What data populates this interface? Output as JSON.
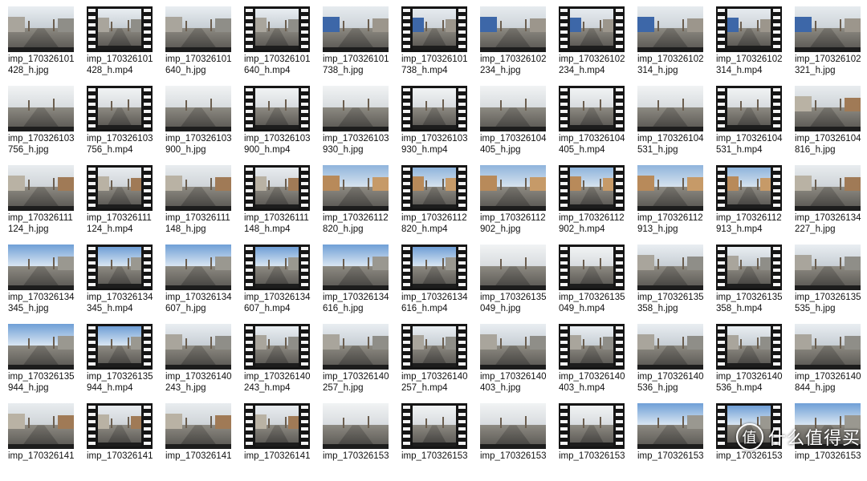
{
  "files": [
    {
      "line1": "imp_170326101",
      "line2": "428_h.jpg",
      "type": "jpg",
      "scene": "city"
    },
    {
      "line1": "imp_170326101",
      "line2": "428_h.mp4",
      "type": "mp4",
      "scene": "city"
    },
    {
      "line1": "imp_170326101",
      "line2": "640_h.jpg",
      "type": "jpg",
      "scene": "city"
    },
    {
      "line1": "imp_170326101",
      "line2": "640_h.mp4",
      "type": "mp4",
      "scene": "city"
    },
    {
      "line1": "imp_170326101",
      "line2": "738_h.jpg",
      "type": "jpg",
      "scene": "bluewall"
    },
    {
      "line1": "imp_170326101",
      "line2": "738_h.mp4",
      "type": "mp4",
      "scene": "bluewall"
    },
    {
      "line1": "imp_170326102",
      "line2": "234_h.jpg",
      "type": "jpg",
      "scene": "bluewall"
    },
    {
      "line1": "imp_170326102",
      "line2": "234_h.mp4",
      "type": "mp4",
      "scene": "bluewall"
    },
    {
      "line1": "imp_170326102",
      "line2": "314_h.jpg",
      "type": "jpg",
      "scene": "bluewall"
    },
    {
      "line1": "imp_170326102",
      "line2": "314_h.mp4",
      "type": "mp4",
      "scene": "bluewall"
    },
    {
      "line1": "imp_170326102",
      "line2": "321_h.jpg",
      "type": "jpg",
      "scene": "bluewall"
    },
    {
      "line1": "imp_170326103",
      "line2": "756_h.jpg",
      "type": "jpg",
      "scene": "open"
    },
    {
      "line1": "imp_170326103",
      "line2": "756_h.mp4",
      "type": "mp4",
      "scene": "open"
    },
    {
      "line1": "imp_170326103",
      "line2": "900_h.jpg",
      "type": "jpg",
      "scene": "open"
    },
    {
      "line1": "imp_170326103",
      "line2": "900_h.mp4",
      "type": "mp4",
      "scene": "open"
    },
    {
      "line1": "imp_170326103",
      "line2": "930_h.jpg",
      "type": "jpg",
      "scene": "open"
    },
    {
      "line1": "imp_170326103",
      "line2": "930_h.mp4",
      "type": "mp4",
      "scene": "open"
    },
    {
      "line1": "imp_170326104",
      "line2": "405_h.jpg",
      "type": "jpg",
      "scene": "open"
    },
    {
      "line1": "imp_170326104",
      "line2": "405_h.mp4",
      "type": "mp4",
      "scene": "open"
    },
    {
      "line1": "imp_170326104",
      "line2": "531_h.jpg",
      "type": "jpg",
      "scene": "open"
    },
    {
      "line1": "imp_170326104",
      "line2": "531_h.mp4",
      "type": "mp4",
      "scene": "open"
    },
    {
      "line1": "imp_170326104",
      "line2": "816_h.jpg",
      "type": "jpg",
      "scene": "village"
    },
    {
      "line1": "imp_170326111",
      "line2": "124_h.jpg",
      "type": "jpg",
      "scene": "village"
    },
    {
      "line1": "imp_170326111",
      "line2": "124_h.mp4",
      "type": "mp4",
      "scene": "village"
    },
    {
      "line1": "imp_170326111",
      "line2": "148_h.jpg",
      "type": "jpg",
      "scene": "village"
    },
    {
      "line1": "imp_170326111",
      "line2": "148_h.mp4",
      "type": "mp4",
      "scene": "village"
    },
    {
      "line1": "imp_170326112",
      "line2": "820_h.jpg",
      "type": "jpg",
      "scene": "brick"
    },
    {
      "line1": "imp_170326112",
      "line2": "820_h.mp4",
      "type": "mp4",
      "scene": "brick"
    },
    {
      "line1": "imp_170326112",
      "line2": "902_h.jpg",
      "type": "jpg",
      "scene": "brick"
    },
    {
      "line1": "imp_170326112",
      "line2": "902_h.mp4",
      "type": "mp4",
      "scene": "brick"
    },
    {
      "line1": "imp_170326112",
      "line2": "913_h.jpg",
      "type": "jpg",
      "scene": "brick"
    },
    {
      "line1": "imp_170326112",
      "line2": "913_h.mp4",
      "type": "mp4",
      "scene": "brick"
    },
    {
      "line1": "imp_170326134",
      "line2": "227_h.jpg",
      "type": "jpg",
      "scene": "village"
    },
    {
      "line1": "imp_170326134",
      "line2": "345_h.jpg",
      "type": "jpg",
      "scene": "bluesky"
    },
    {
      "line1": "imp_170326134",
      "line2": "345_h.mp4",
      "type": "mp4",
      "scene": "bluesky"
    },
    {
      "line1": "imp_170326134",
      "line2": "607_h.jpg",
      "type": "jpg",
      "scene": "bluesky"
    },
    {
      "line1": "imp_170326134",
      "line2": "607_h.mp4",
      "type": "mp4",
      "scene": "bluesky"
    },
    {
      "line1": "imp_170326134",
      "line2": "616_h.jpg",
      "type": "jpg",
      "scene": "bluesky"
    },
    {
      "line1": "imp_170326134",
      "line2": "616_h.mp4",
      "type": "mp4",
      "scene": "bluesky"
    },
    {
      "line1": "imp_170326135",
      "line2": "049_h.jpg",
      "type": "jpg",
      "scene": "open"
    },
    {
      "line1": "imp_170326135",
      "line2": "049_h.mp4",
      "type": "mp4",
      "scene": "open"
    },
    {
      "line1": "imp_170326135",
      "line2": "358_h.jpg",
      "type": "jpg",
      "scene": "city"
    },
    {
      "line1": "imp_170326135",
      "line2": "358_h.mp4",
      "type": "mp4",
      "scene": "city"
    },
    {
      "line1": "imp_170326135",
      "line2": "535_h.jpg",
      "type": "jpg",
      "scene": "city"
    },
    {
      "line1": "imp_170326135",
      "line2": "944_h.jpg",
      "type": "jpg",
      "scene": "bluesky"
    },
    {
      "line1": "imp_170326135",
      "line2": "944_h.mp4",
      "type": "mp4",
      "scene": "bluesky"
    },
    {
      "line1": "imp_170326140",
      "line2": "243_h.jpg",
      "type": "jpg",
      "scene": "city"
    },
    {
      "line1": "imp_170326140",
      "line2": "243_h.mp4",
      "type": "mp4",
      "scene": "city"
    },
    {
      "line1": "imp_170326140",
      "line2": "257_h.jpg",
      "type": "jpg",
      "scene": "city"
    },
    {
      "line1": "imp_170326140",
      "line2": "257_h.mp4",
      "type": "mp4",
      "scene": "city"
    },
    {
      "line1": "imp_170326140",
      "line2": "403_h.jpg",
      "type": "jpg",
      "scene": "city"
    },
    {
      "line1": "imp_170326140",
      "line2": "403_h.mp4",
      "type": "mp4",
      "scene": "city"
    },
    {
      "line1": "imp_170326140",
      "line2": "536_h.jpg",
      "type": "jpg",
      "scene": "city"
    },
    {
      "line1": "imp_170326140",
      "line2": "536_h.mp4",
      "type": "mp4",
      "scene": "city"
    },
    {
      "line1": "imp_170326140",
      "line2": "844_h.jpg",
      "type": "jpg",
      "scene": "city"
    },
    {
      "line1": "imp_170326141",
      "line2": "",
      "type": "jpg",
      "scene": "village"
    },
    {
      "line1": "imp_170326141",
      "line2": "",
      "type": "mp4",
      "scene": "village"
    },
    {
      "line1": "imp_170326141",
      "line2": "",
      "type": "jpg",
      "scene": "village"
    },
    {
      "line1": "imp_170326141",
      "line2": "",
      "type": "mp4",
      "scene": "village"
    },
    {
      "line1": "imp_170326153",
      "line2": "",
      "type": "jpg",
      "scene": "open"
    },
    {
      "line1": "imp_170326153",
      "line2": "",
      "type": "mp4",
      "scene": "open"
    },
    {
      "line1": "imp_170326153",
      "line2": "",
      "type": "jpg",
      "scene": "open"
    },
    {
      "line1": "imp_170326153",
      "line2": "",
      "type": "mp4",
      "scene": "open"
    },
    {
      "line1": "imp_170326153",
      "line2": "",
      "type": "jpg",
      "scene": "bluesky"
    },
    {
      "line1": "imp_170326153",
      "line2": "",
      "type": "mp4",
      "scene": "bluesky"
    },
    {
      "line1": "imp_170326153",
      "line2": "",
      "type": "jpg",
      "scene": "bluesky"
    }
  ],
  "watermark": {
    "icon_char": "值",
    "text": "什么值得买"
  },
  "colors": {
    "film": "#151515",
    "text": "#111111",
    "background": "#ffffff"
  }
}
